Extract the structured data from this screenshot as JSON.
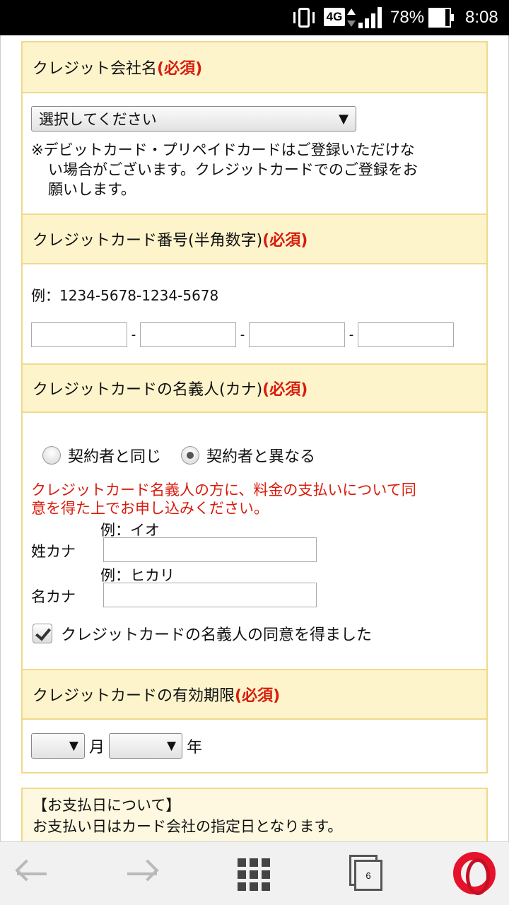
{
  "status_bar": {
    "network": "4G",
    "battery": "78%",
    "battery_level": 0.78,
    "time": "8:08"
  },
  "credit_company": {
    "label": "クレジット会社名",
    "required": "(必須)",
    "select_value": "選択してください",
    "note_lines": [
      "※デビットカード・プリペイドカードはご登録いただけな",
      "い場合がございます。クレジットカードでのご登録をお",
      "願いします。"
    ]
  },
  "card_number": {
    "label": "クレジットカード番号(半角数字)",
    "required": "(必須)",
    "example": "例：1234-5678-1234-5678",
    "separator": "-"
  },
  "card_holder": {
    "label": "クレジットカードの名義人(カナ)",
    "required": "(必須)",
    "radio_same": "契約者と同じ",
    "radio_different": "契約者と異なる",
    "selected": "契約者と異なる",
    "warning_lines": [
      "クレジットカード名義人の方に、料金の支払いについて同",
      "意を得た上でお申し込みください。"
    ],
    "last_name_example": "例：イオ",
    "last_name_label": "姓カナ",
    "first_name_example": "例：ヒカリ",
    "first_name_label": "名カナ",
    "consent_label": "クレジットカードの名義人の同意を得ました",
    "consent_checked": true
  },
  "expiry": {
    "label": "クレジットカードの有効期限",
    "required": "(必須)",
    "month_unit": "月",
    "year_unit": "年",
    "arrow": "▼"
  },
  "payday": {
    "title": "【お支払日について】",
    "text": "お支払い日はカード会社の指定日となります。"
  },
  "bottom_nav": {
    "tab_count": "6"
  },
  "colors": {
    "required": "#d81c0c",
    "section_header_bg": "#fdf4cc",
    "section_border": "#f0d98a",
    "opera": "#e6122b"
  }
}
